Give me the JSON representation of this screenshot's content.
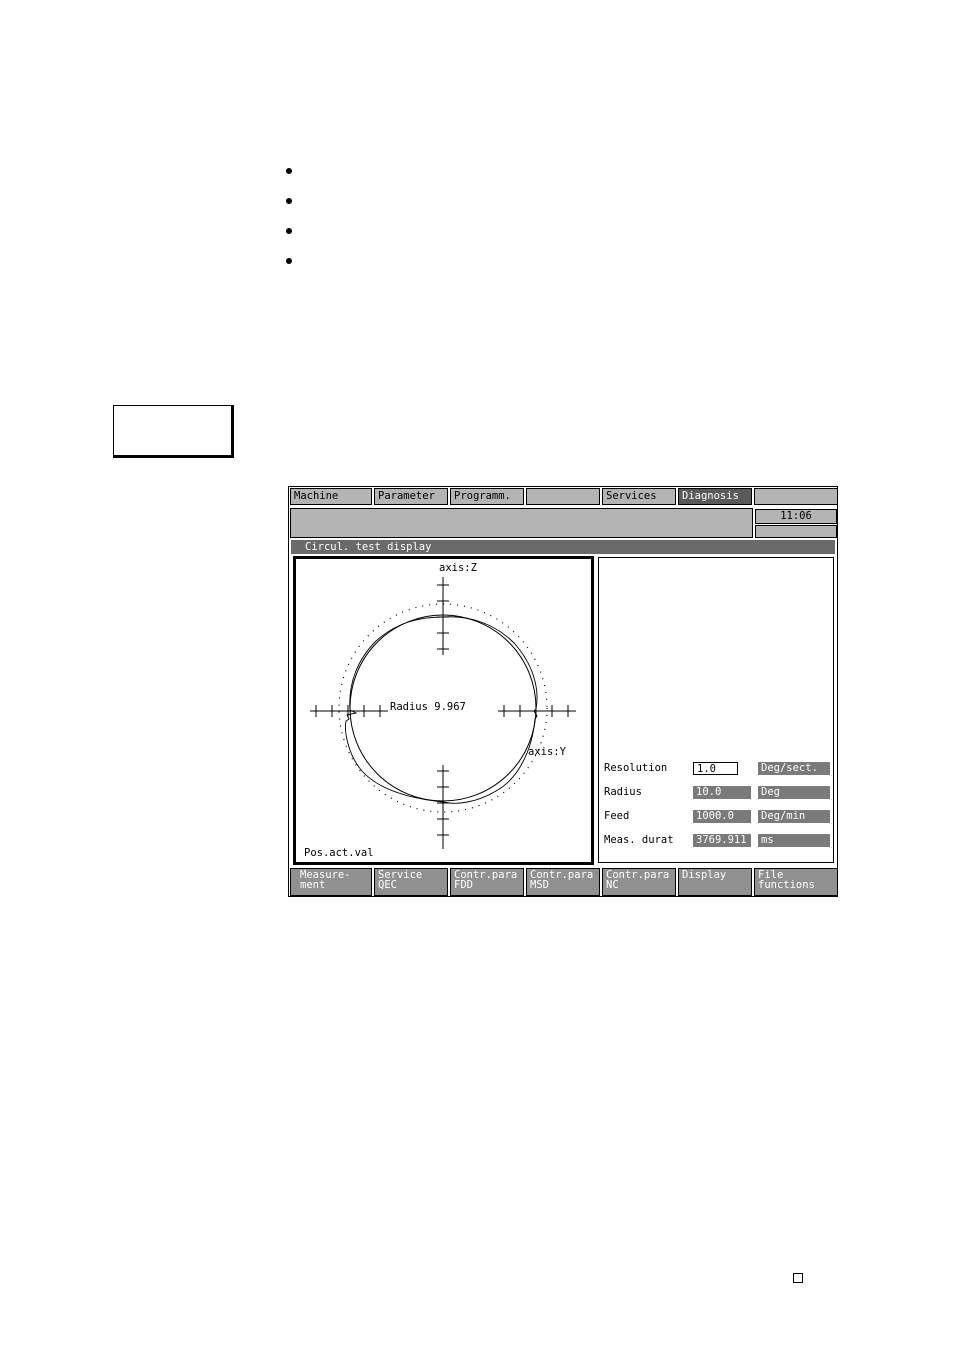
{
  "menu": {
    "items": [
      "Machine",
      "Parameter",
      "Programm.",
      "",
      "Services",
      "Diagnosis",
      ""
    ],
    "active_index": 5
  },
  "status": {
    "message": "",
    "time": "11:06"
  },
  "window": {
    "title": "Circul. test display"
  },
  "plot": {
    "axis_vertical": "axis:Z",
    "axis_horizontal": "axis:Y",
    "radius_label": "Radius 9.967",
    "mode_label": "Pos.act.val"
  },
  "params": [
    {
      "label": "Resolution",
      "value": "1.0",
      "unit": "Deg/sect.",
      "editable": true
    },
    {
      "label": "Radius",
      "value": "10.0",
      "unit": "Deg",
      "editable": false
    },
    {
      "label": "Feed",
      "value": "1000.0",
      "unit": "Deg/min",
      "editable": false
    },
    {
      "label": "Meas. durat",
      "value": "3769.911",
      "unit": "ms",
      "editable": false
    }
  ],
  "softkeys": [
    "Measure-\nment",
    "Service\nQEC",
    "Contr.para\nFDD",
    "Contr.para\nMSD",
    "Contr.para\nNC",
    "Display",
    "File\nfunctions"
  ],
  "colors": {
    "panel_gray": "#b4b4b4",
    "active_tab": "#5a5a5a",
    "title_bar": "#6a6a6a",
    "value_field": "#7a7a7a",
    "softkey": "#909090"
  }
}
